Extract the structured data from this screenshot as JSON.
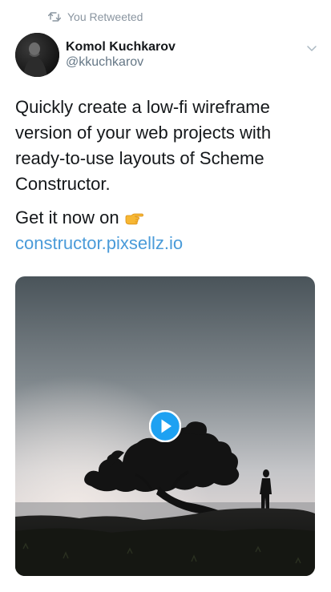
{
  "context": {
    "retweet_label": "You Retweeted",
    "retweet_icon": "retweet-icon"
  },
  "author": {
    "name": "Komol Kuchkarov",
    "handle": "@kkuchkarov",
    "avatar_icon": "avatar-photo"
  },
  "tweet": {
    "text": "Quickly create a low-fi wireframe version of your web projects with ready-to-use layouts of Scheme Constructor.",
    "cta_text": "Get it now on",
    "cta_emoji": "pointing-right-hand-emoji",
    "link_text": "constructor.pixsellz.io"
  },
  "media": {
    "type": "video",
    "description_icon": "tree-silhouette-photo",
    "play_icon": "play-icon"
  },
  "colors": {
    "link": "#4a9bd9",
    "play_button": "#1da1f2",
    "muted_text": "#8a95a0"
  }
}
